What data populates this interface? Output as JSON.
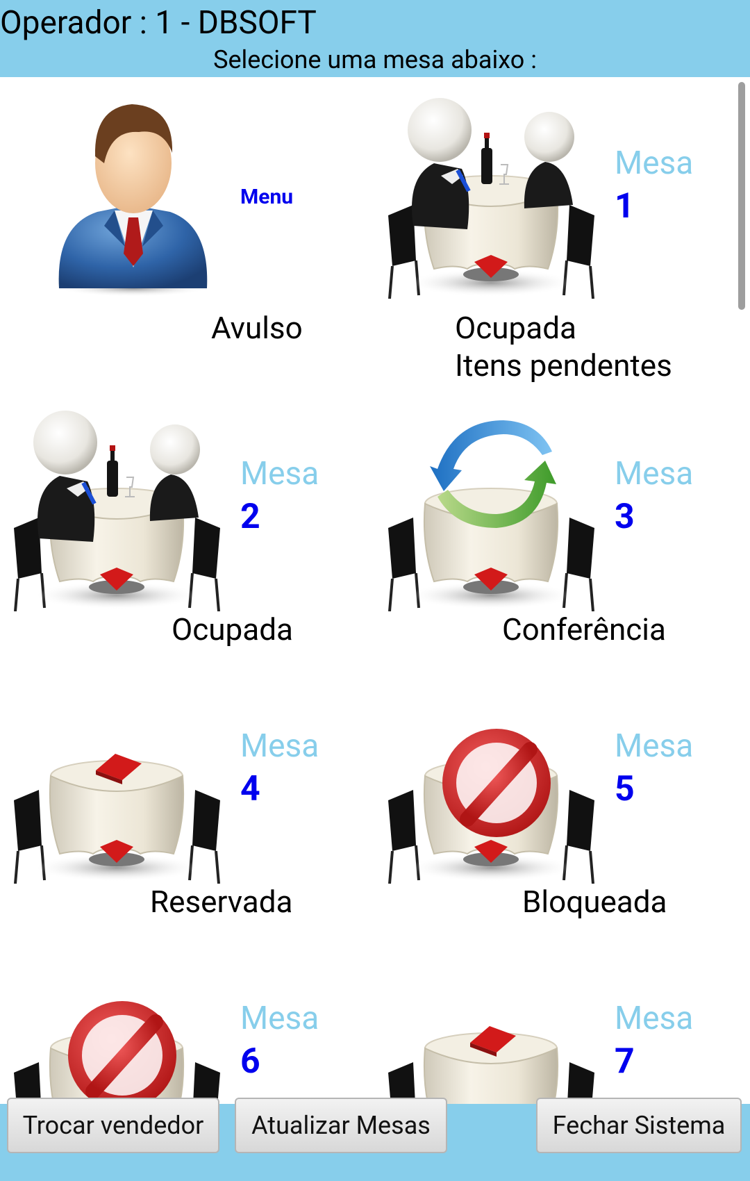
{
  "header": {
    "operator": "Operador : 1 - DBSOFT",
    "instruction": "Selecione uma mesa abaixo :"
  },
  "tiles": [
    {
      "type": "menu",
      "menu_label": "Menu",
      "status": "Avulso",
      "icon": "businessman-icon"
    },
    {
      "mesa_word": "Mesa",
      "number": "1",
      "status_line1": "Ocupada",
      "status_line2": "Itens pendentes",
      "icon": "table-occupied-icon"
    },
    {
      "mesa_word": "Mesa",
      "number": "2",
      "status": "Ocupada",
      "icon": "table-occupied-icon"
    },
    {
      "mesa_word": "Mesa",
      "number": "3",
      "status": "Conferência",
      "icon": "table-refresh-icon"
    },
    {
      "mesa_word": "Mesa",
      "number": "4",
      "status": "Reservada",
      "icon": "table-reserved-icon"
    },
    {
      "mesa_word": "Mesa",
      "number": "5",
      "status": "Bloqueada",
      "icon": "table-blocked-icon"
    },
    {
      "mesa_word": "Mesa",
      "number": "6",
      "icon": "table-blocked-icon"
    },
    {
      "mesa_word": "Mesa",
      "number": "7",
      "icon": "table-reserved-icon"
    }
  ],
  "footer": {
    "trocar": "Trocar vendedor",
    "atualizar": "Atualizar Mesas",
    "fechar": "Fechar Sistema"
  },
  "colors": {
    "bar": "#87CEEB",
    "mesa_word": "#87CEEB",
    "mesa_number": "#0000EE"
  }
}
